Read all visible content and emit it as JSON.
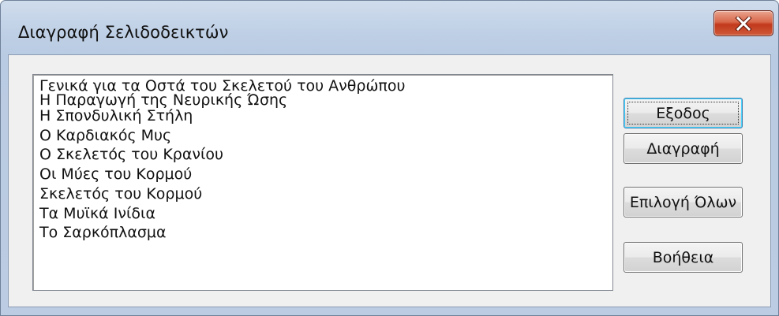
{
  "window": {
    "title": "Διαγραφή Σελιδοδεικτών",
    "close_icon": "close-x-icon",
    "close_button_color": "#c2391d"
  },
  "bookmarks": {
    "items": [
      "Γενικά για τα Οστά του Σκελετού του Ανθρώπου",
      "Η Παραγωγή της Νευρικής Ώσης",
      "Η Σπονδυλική Στήλη",
      "Ο Καρδιακός Μυς",
      "Ο Σκελετός του Κρανίου",
      "Οι Μύες του Κορμού",
      "Σκελετός του  Κορμού",
      "Τα Μυϊκά Ινίδια",
      "Το Σαρκόπλασμα"
    ]
  },
  "buttons": {
    "exit": "Εξοδος",
    "delete": "Διαγραφή",
    "select_all": "Επιλογή Όλων",
    "help": "Βοήθεια"
  }
}
